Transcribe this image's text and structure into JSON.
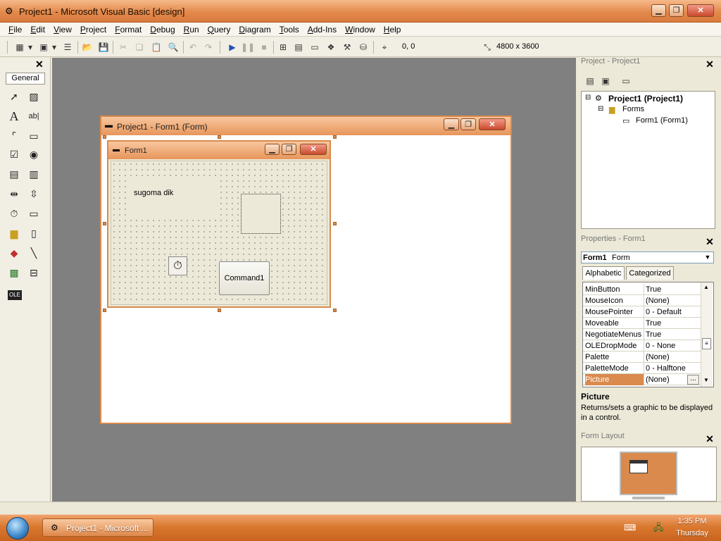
{
  "window": {
    "title": "Project1 - Microsoft Visual Basic [design]",
    "min_glyph": "▁",
    "max_glyph": "❐",
    "close_glyph": "✕"
  },
  "menu": [
    "File",
    "Edit",
    "View",
    "Project",
    "Format",
    "Debug",
    "Run",
    "Query",
    "Diagram",
    "Tools",
    "Add-Ins",
    "Window",
    "Help"
  ],
  "toolbar": {
    "position": "0, 0",
    "size": "4800 x 3600"
  },
  "toolbox": {
    "tab_label": "General",
    "close_glyph": "✕",
    "ole_label": "OLE"
  },
  "designer": {
    "title": "Project1 - Form1 (Form)"
  },
  "form1": {
    "title": "Form1",
    "label_text": "sugoma dik",
    "button_label": "Command1"
  },
  "project_explorer": {
    "title": "Project - Project1",
    "root": "Project1 (Project1)",
    "folder": "Forms",
    "item": "Form1 (Form1)"
  },
  "properties": {
    "title": "Properties - Form1",
    "object_name": "Form1",
    "object_type": "Form",
    "tabs": [
      "Alphabetic",
      "Categorized"
    ],
    "rows": [
      {
        "name": "MinButton",
        "value": "True"
      },
      {
        "name": "MouseIcon",
        "value": "(None)"
      },
      {
        "name": "MousePointer",
        "value": "0 - Default"
      },
      {
        "name": "Moveable",
        "value": "True"
      },
      {
        "name": "NegotiateMenus",
        "value": "True"
      },
      {
        "name": "OLEDropMode",
        "value": "0 - None"
      },
      {
        "name": "Palette",
        "value": "(None)"
      },
      {
        "name": "PaletteMode",
        "value": "0 - Halftone"
      },
      {
        "name": "Picture",
        "value": "(None)"
      }
    ],
    "ellipsis": "...",
    "desc_title": "Picture",
    "desc_text": "Returns/sets a graphic to be displayed in a control."
  },
  "form_layout": {
    "title": "Form Layout"
  },
  "taskbar": {
    "item_label": "Project1 - Microsoft ...",
    "time": "1:35 PM",
    "day": "Thursday"
  },
  "colors": {
    "accent": "#d98a4c",
    "workspace": "#808080"
  }
}
